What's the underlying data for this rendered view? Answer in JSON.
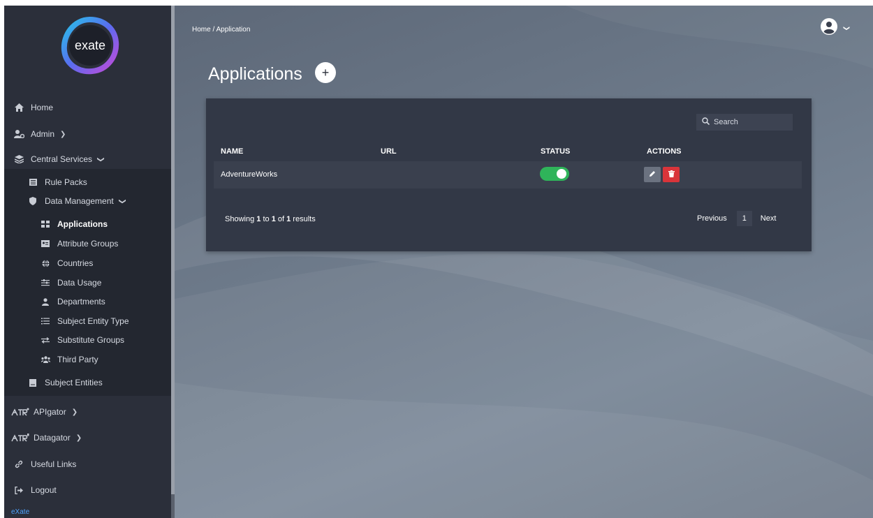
{
  "sidebar": {
    "brand_footer": "eXate",
    "logo_text": "exate",
    "items": [
      {
        "label": "Home",
        "icon": "home-icon"
      },
      {
        "label": "Admin",
        "icon": "users-cog-icon"
      },
      {
        "label": "Central Services",
        "icon": "layers-icon"
      },
      {
        "label": "Rule Packs",
        "icon": "list-icon"
      },
      {
        "label": "Data Management",
        "icon": "shield-icon"
      },
      {
        "label": "Applications",
        "icon": "grid-icon"
      },
      {
        "label": "Attribute Groups",
        "icon": "id-card-icon"
      },
      {
        "label": "Countries",
        "icon": "globe-icon"
      },
      {
        "label": "Data Usage",
        "icon": "sliders-icon"
      },
      {
        "label": "Departments",
        "icon": "user-tie-icon"
      },
      {
        "label": "Subject Entity Type",
        "icon": "list-bullets-icon"
      },
      {
        "label": "Substitute Groups",
        "icon": "exchange-icon"
      },
      {
        "label": "Third Party",
        "icon": "users-icon"
      },
      {
        "label": "Subject Entities",
        "icon": "book-icon"
      },
      {
        "label": "APIgator",
        "icon": "gator-icon"
      },
      {
        "label": "Datagator",
        "icon": "gator-icon"
      },
      {
        "label": "Useful Links",
        "icon": "link-icon"
      },
      {
        "label": "Logout",
        "icon": "sign-out-icon"
      }
    ]
  },
  "header": {
    "breadcrumb": "Home /  Application",
    "title": "Applications",
    "add_label": "+"
  },
  "table": {
    "search_placeholder": "Search",
    "columns": [
      "NAME",
      "URL",
      "STATUS",
      "ACTIONS"
    ],
    "rows": [
      {
        "name": "AdventureWorks",
        "url": "",
        "status": "on"
      }
    ],
    "showing_prefix": "Showing ",
    "showing_from": "1",
    "showing_mid1": " to ",
    "showing_to": "1",
    "showing_mid2": " of ",
    "showing_total": "1",
    "showing_suffix": " results",
    "prev_label": "Previous",
    "page": "1",
    "next_label": "Next"
  },
  "colors": {
    "sidebar_bg": "#2b2f3a",
    "card_bg": "#323846",
    "toggle_on": "#2fb45a",
    "delete": "#d9343a",
    "edit": "#6b7280"
  }
}
